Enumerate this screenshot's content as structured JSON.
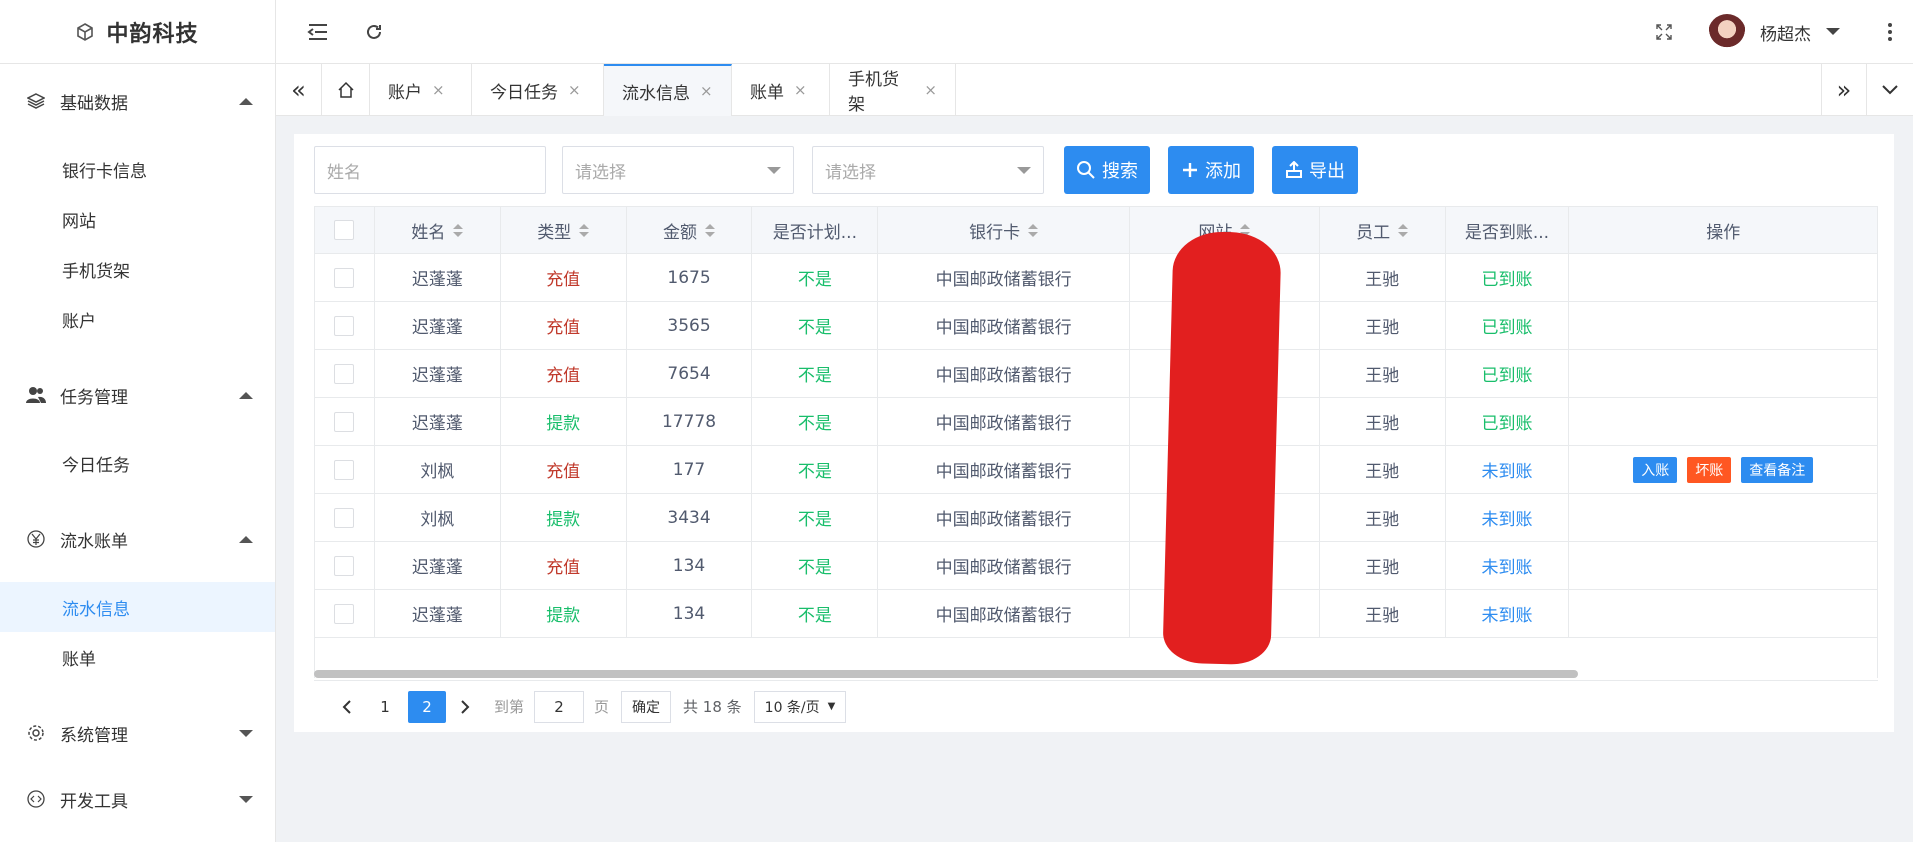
{
  "app": {
    "title": "中韵科技"
  },
  "sidebar": {
    "groups": [
      {
        "label": "基础数据",
        "icon": "layers-icon",
        "expanded": true,
        "items": [
          "银行卡信息",
          "网站",
          "手机货架",
          "账户"
        ]
      },
      {
        "label": "任务管理",
        "icon": "users-icon",
        "expanded": true,
        "items": [
          "今日任务"
        ]
      },
      {
        "label": "流水账单",
        "icon": "yen-icon",
        "expanded": true,
        "items": [
          "流水信息",
          "账单"
        ],
        "active": "流水信息"
      },
      {
        "label": "系统管理",
        "icon": "gear-icon",
        "expanded": false,
        "items": []
      },
      {
        "label": "开发工具",
        "icon": "code-icon",
        "expanded": false,
        "items": []
      }
    ]
  },
  "header": {
    "user_name": "杨超杰"
  },
  "tabs": [
    {
      "label": "账户",
      "closable": true
    },
    {
      "label": "今日任务",
      "closable": true
    },
    {
      "label": "流水信息",
      "closable": true,
      "active": true
    },
    {
      "label": "账单",
      "closable": true
    },
    {
      "label": "手机货架",
      "closable": true
    }
  ],
  "toolbar": {
    "name_placeholder": "姓名",
    "select1_placeholder": "请选择",
    "select2_placeholder": "请选择",
    "search_label": "搜索",
    "add_label": "添加",
    "export_label": "导出"
  },
  "table": {
    "columns": [
      "姓名",
      "类型",
      "金额",
      "是否计划...",
      "银行卡",
      "网站",
      "员工",
      "是否到账...",
      "操作"
    ],
    "rows": [
      {
        "name": "迟蓬蓬",
        "type": "充值",
        "amount": "1675",
        "planned": "不是",
        "bank": "中国邮政储蓄银行",
        "site": "",
        "staff": "王驰",
        "arrived": "已到账",
        "actions": []
      },
      {
        "name": "迟蓬蓬",
        "type": "充值",
        "amount": "3565",
        "planned": "不是",
        "bank": "中国邮政储蓄银行",
        "site": "",
        "staff": "王驰",
        "arrived": "已到账",
        "actions": []
      },
      {
        "name": "迟蓬蓬",
        "type": "充值",
        "amount": "7654",
        "planned": "不是",
        "bank": "中国邮政储蓄银行",
        "site": "",
        "staff": "王驰",
        "arrived": "已到账",
        "actions": []
      },
      {
        "name": "迟蓬蓬",
        "type": "提款",
        "amount": "17778",
        "planned": "不是",
        "bank": "中国邮政储蓄银行",
        "site": "",
        "staff": "王驰",
        "arrived": "已到账",
        "actions": []
      },
      {
        "name": "刘枫",
        "type": "充值",
        "amount": "177",
        "planned": "不是",
        "bank": "中国邮政储蓄银行",
        "site": "",
        "staff": "王驰",
        "arrived": "未到账",
        "actions": [
          "入账",
          "坏账",
          "查看备注"
        ]
      },
      {
        "name": "刘枫",
        "type": "提款",
        "amount": "3434",
        "planned": "不是",
        "bank": "中国邮政储蓄银行",
        "site": "",
        "staff": "王驰",
        "arrived": "未到账",
        "actions": []
      },
      {
        "name": "迟蓬蓬",
        "type": "充值",
        "amount": "134",
        "planned": "不是",
        "bank": "中国邮政储蓄银行",
        "site": "",
        "staff": "王驰",
        "arrived": "未到账",
        "actions": []
      },
      {
        "name": "迟蓬蓬",
        "type": "提款",
        "amount": "134",
        "planned": "不是",
        "bank": "中国邮政储蓄银行",
        "site": "",
        "staff": "王驰",
        "arrived": "未到账",
        "actions": []
      }
    ]
  },
  "pagination": {
    "pages": [
      "1",
      "2"
    ],
    "current": "2",
    "goto_label": "到第",
    "goto_value": "2",
    "page_unit": "页",
    "confirm_label": "确定",
    "total_text": "共 18 条",
    "page_size": "10 条/页"
  },
  "colors": {
    "primary": "#2d8cf0",
    "recharge": "#c0392b",
    "withdraw": "#19be6b",
    "arrived": "#19be6b",
    "not_arrived": "#2d8cf0",
    "action_in": "#2d8cf0",
    "action_bad": "#ff5722",
    "action_note": "#2d8cf0",
    "redaction": "#e21f1f"
  }
}
